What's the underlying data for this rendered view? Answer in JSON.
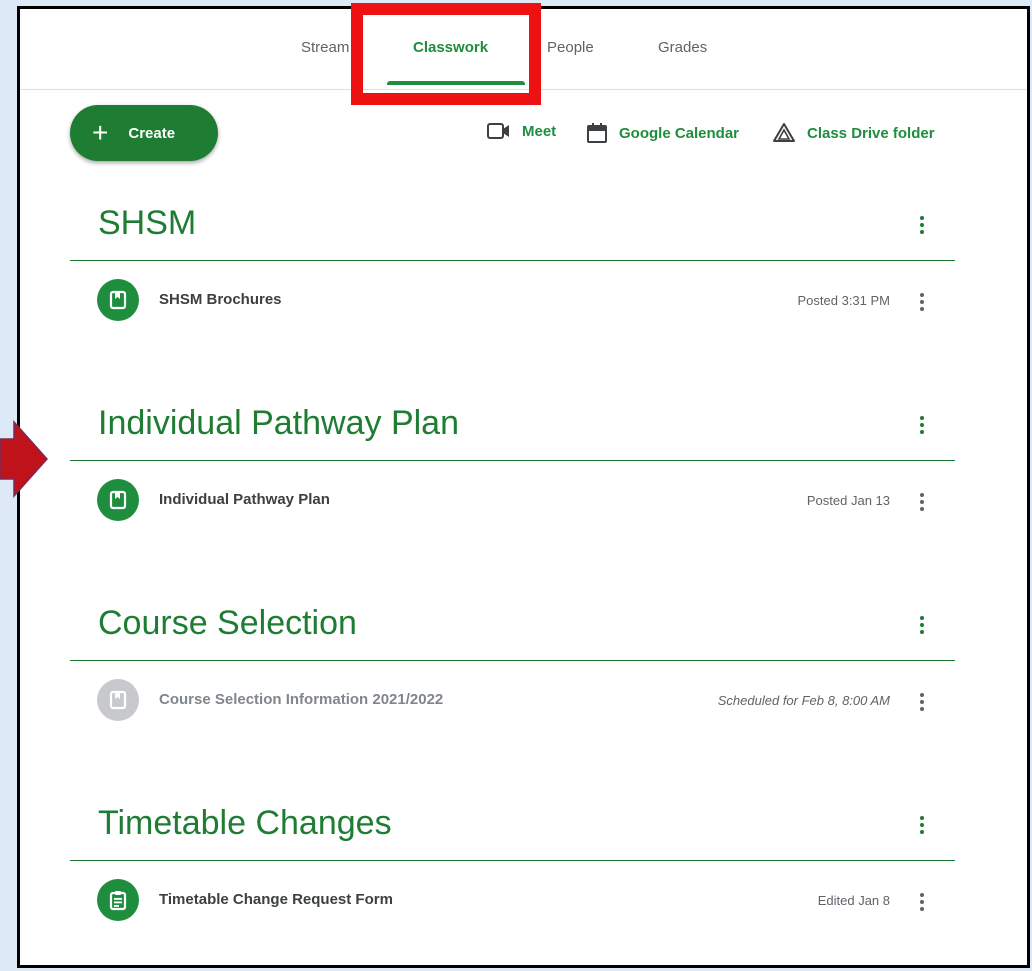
{
  "tabs": [
    {
      "label": "Stream",
      "active": false
    },
    {
      "label": "Classwork",
      "active": true
    },
    {
      "label": "People",
      "active": false
    },
    {
      "label": "Grades",
      "active": false
    }
  ],
  "create_button": {
    "label": "Create",
    "icon": "plus-icon"
  },
  "toolbar_links": [
    {
      "label": "Meet",
      "icon": "video-camera-icon"
    },
    {
      "label": "Google Calendar",
      "icon": "calendar-icon"
    },
    {
      "label": "Class Drive folder",
      "icon": "drive-icon"
    }
  ],
  "topics": [
    {
      "title": "SHSM",
      "items": [
        {
          "title": "SHSM Brochures",
          "meta": "Posted 3:31 PM",
          "icon": "material-icon",
          "status": "posted"
        }
      ]
    },
    {
      "title": "Individual Pathway Plan",
      "items": [
        {
          "title": "Individual Pathway Plan",
          "meta": "Posted Jan 13",
          "icon": "material-icon",
          "status": "posted"
        }
      ]
    },
    {
      "title": "Course Selection",
      "items": [
        {
          "title": "Course Selection Information 2021/2022",
          "meta": "Scheduled for Feb 8, 8:00 AM",
          "icon": "material-icon",
          "status": "scheduled"
        }
      ]
    },
    {
      "title": "Timetable Changes",
      "items": [
        {
          "title": "Timetable Change Request Form",
          "meta": "Edited Jan 8",
          "icon": "assignment-icon",
          "status": "posted"
        }
      ]
    }
  ],
  "colors": {
    "accent": "#1e8e3e",
    "accent_dark": "#1e7d32",
    "highlight": "#ee1111",
    "arrow": "#c0121b",
    "muted_icon": "#c7c9cc",
    "page_bg": "#dde9f6"
  }
}
